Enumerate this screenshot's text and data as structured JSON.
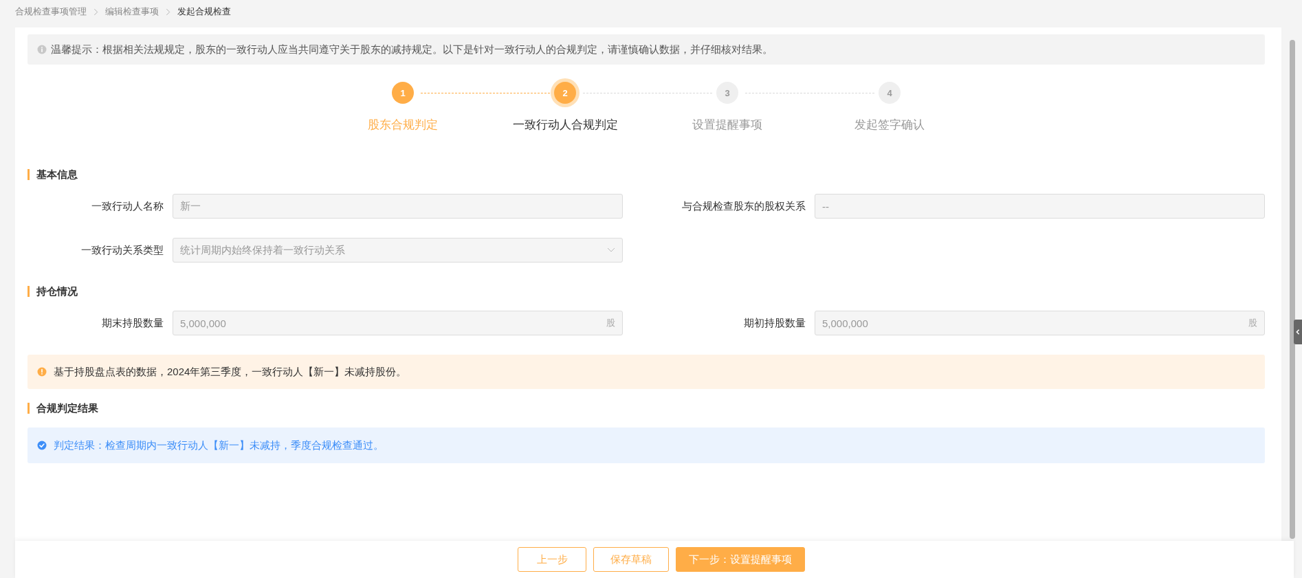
{
  "breadcrumb": [
    {
      "label": "合规检查事项管理",
      "selected": false
    },
    {
      "label": "编辑检查事项",
      "selected": false
    },
    {
      "label": "发起合规检查",
      "selected": true
    }
  ],
  "notice": {
    "text": "温馨提示：根据相关法规规定，股东的一致行动人应当共同遵守关于股东的减持规定。以下是针对一致行动人的合规判定，请谨慎确认数据，并仔细核对结果。"
  },
  "steps": [
    {
      "number": "1",
      "label": "股东合规判定",
      "kind": "finish"
    },
    {
      "number": "2",
      "label": "一致行动人合规判定",
      "kind": "process"
    },
    {
      "number": "3",
      "label": "设置提醒事项",
      "kind": "wait"
    },
    {
      "number": "4",
      "label": "发起签字确认",
      "kind": "wait"
    }
  ],
  "sections": [
    {
      "title": "基本信息",
      "fields": [
        {
          "kind": "text",
          "label": "一致行动人名称",
          "value": "新一",
          "disabled": true
        },
        {
          "kind": "text",
          "label": "与合规检查股东的股权关系",
          "value": "--",
          "disabled": true
        },
        {
          "kind": "select",
          "label": "一致行动关系类型",
          "value": "统计周期内始终保持着一致行动关系",
          "disabled": true
        }
      ]
    },
    {
      "title": "持仓情况",
      "fields": [
        {
          "kind": "number",
          "label": "期末持股数量",
          "value": "5,000,000",
          "suffix": "股",
          "disabled": true
        },
        {
          "kind": "number",
          "label": "期初持股数量",
          "value": "5,000,000",
          "suffix": "股",
          "disabled": true
        }
      ],
      "alert": {
        "kind": "warning",
        "text": "基于持股盘点表的数据，2024年第三季度，一致行动人【新一】未减持股份。"
      }
    },
    {
      "title": "合规判定结果",
      "alert": {
        "kind": "info",
        "text": "判定结果：检查周期内一致行动人【新一】未减持，季度合规检查通过。"
      }
    }
  ],
  "buttons": [
    {
      "label": "上一步",
      "kind": "default"
    },
    {
      "label": "保存草稿",
      "kind": "default"
    },
    {
      "label": "下一步：设置提醒事项",
      "kind": "primary"
    }
  ]
}
